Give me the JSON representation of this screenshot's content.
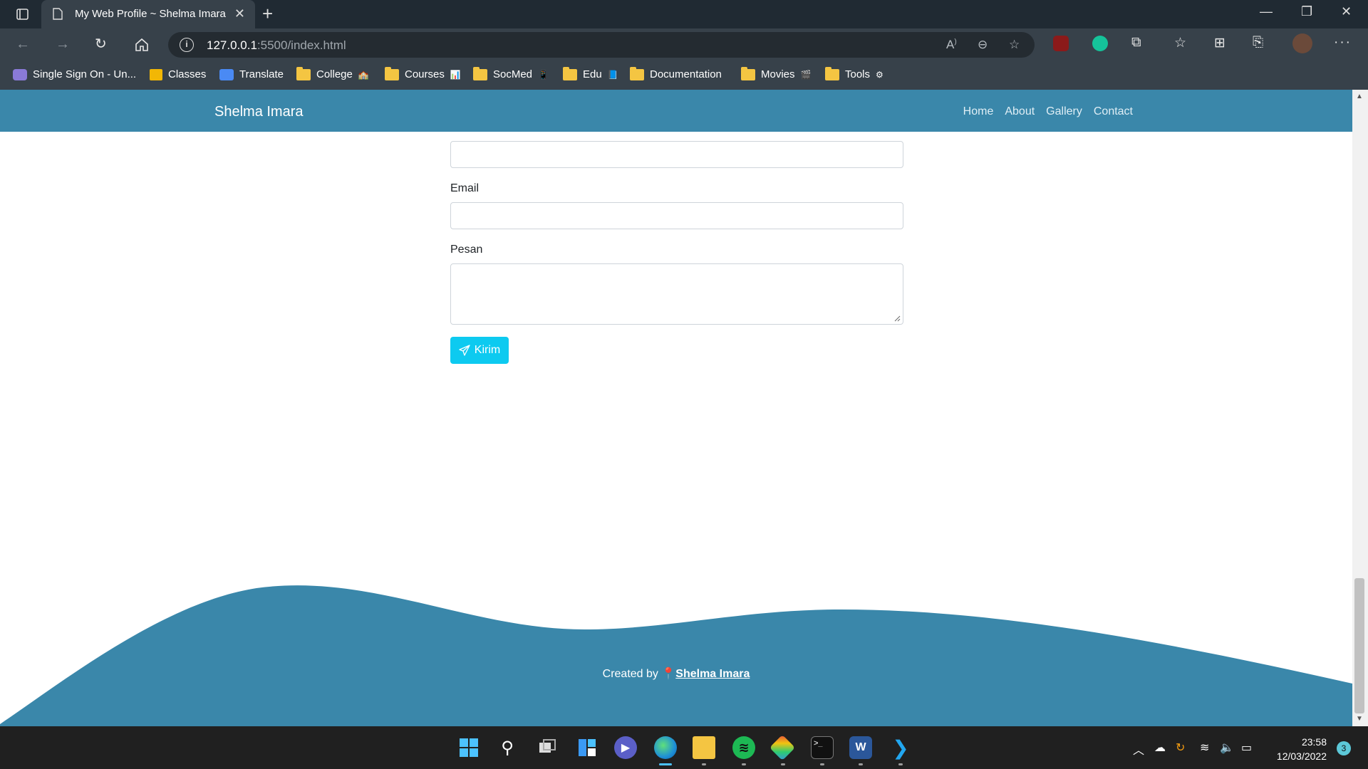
{
  "browser": {
    "tab_title": "My Web Profile ~ Shelma Imara",
    "url_host": "127.0.0.1",
    "url_path": ":5500/index.html",
    "bookmarks": [
      {
        "label": "Single Sign On - Un...",
        "icon": "sso-icon"
      },
      {
        "label": "Classes",
        "icon": "classroom-icon"
      },
      {
        "label": "Translate",
        "icon": "translate-icon"
      },
      {
        "label": "College",
        "icon": "folder-icon",
        "emoji": "🏫"
      },
      {
        "label": "Courses",
        "icon": "folder-icon",
        "emoji": "📊"
      },
      {
        "label": "SocMed",
        "icon": "folder-icon",
        "emoji": "📱"
      },
      {
        "label": "Edu",
        "icon": "folder-icon",
        "emoji": "📘"
      },
      {
        "label": "Documentation",
        "icon": "folder-icon"
      },
      {
        "label": "Movies",
        "icon": "folder-icon",
        "emoji": "🎬"
      },
      {
        "label": "Tools",
        "icon": "folder-icon",
        "emoji": "⚙"
      }
    ]
  },
  "site": {
    "brand": "Shelma Imara",
    "nav": [
      "Home",
      "About",
      "Gallery",
      "Contact"
    ],
    "form": {
      "email_label": "Email",
      "message_label": "Pesan",
      "submit_label": "Kirim"
    },
    "footer": {
      "prefix": "Created by",
      "author": "Shelma Imara"
    },
    "colors": {
      "primary": "#3a87aa",
      "button": "#0dcaf0"
    }
  },
  "taskbar": {
    "time": "23:58",
    "date": "12/03/2022",
    "notifications": "3"
  }
}
